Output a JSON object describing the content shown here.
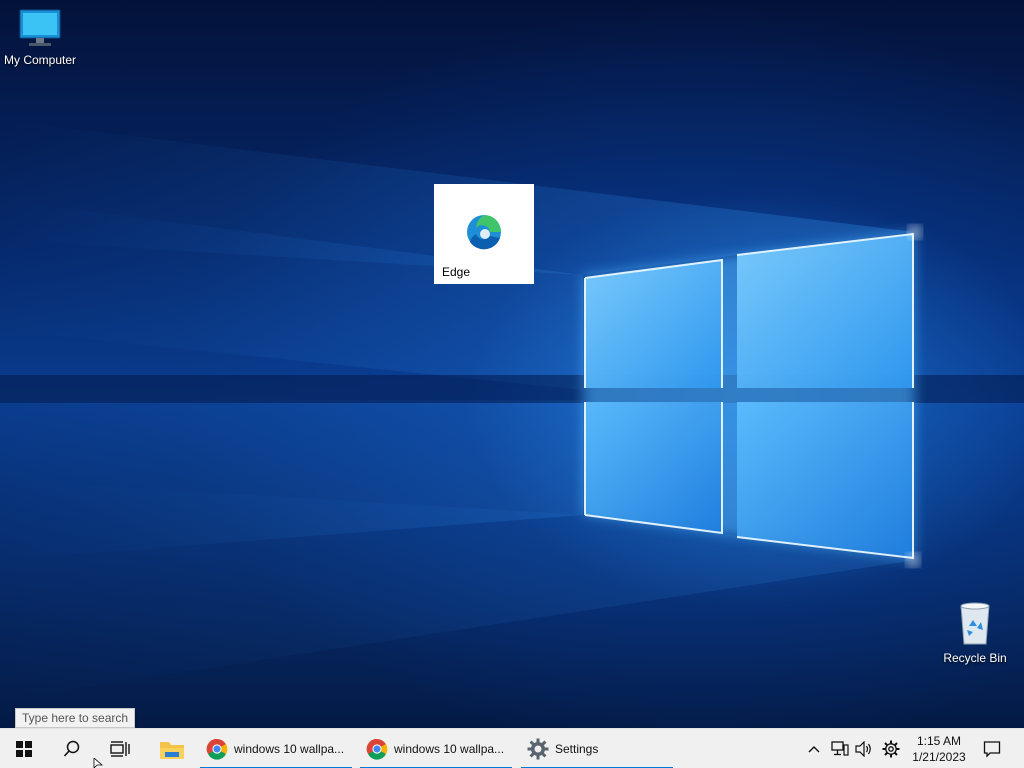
{
  "desktop": {
    "icons": [
      {
        "id": "my-computer",
        "label": "My Computer",
        "icon": "monitor-icon"
      },
      {
        "id": "edge",
        "label": "Edge",
        "icon": "edge-icon"
      },
      {
        "id": "recycle-bin",
        "label": "Recycle Bin",
        "icon": "recycle-bin-icon"
      }
    ]
  },
  "tooltip": {
    "text": "Type here to search"
  },
  "taskbar": {
    "start_icon": "windows-logo-icon",
    "search_icon": "search-icon",
    "taskview_icon": "task-view-icon",
    "pinned": [
      {
        "icon": "file-explorer-icon"
      }
    ],
    "apps": [
      {
        "label": "windows 10 wallpa...",
        "icon": "chrome-icon"
      },
      {
        "label": "windows 10 wallpa...",
        "icon": "chrome-icon"
      },
      {
        "label": "Settings",
        "icon": "settings-gear-icon"
      }
    ],
    "tray": {
      "chevron_icon": "chevron-up-icon",
      "network_icon": "network-icon",
      "volume_icon": "volume-icon",
      "settings_icon": "gear-icon",
      "time": "1:15 AM",
      "date": "1/21/2023",
      "notifications_icon": "notification-icon"
    }
  },
  "colors": {
    "accent": "#0078d7",
    "taskbar_bg": "#f0f0f0"
  }
}
